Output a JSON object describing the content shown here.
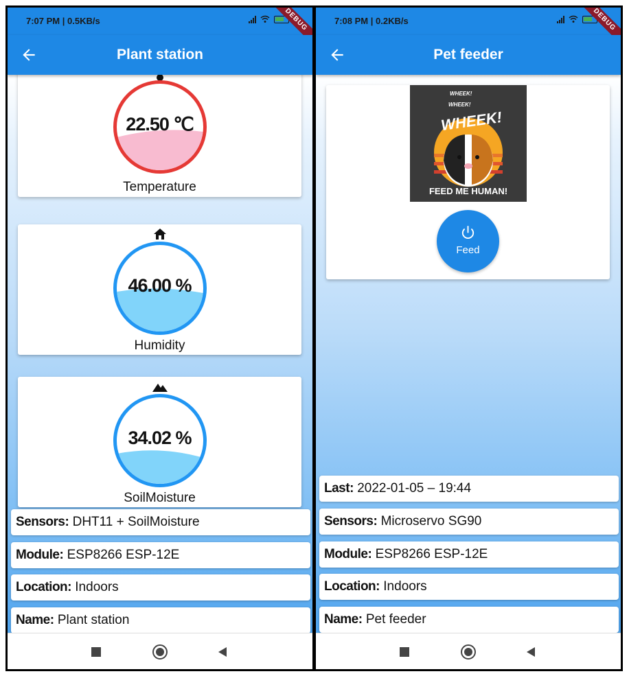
{
  "left": {
    "status": {
      "time": "7:07 PM | 0.5KB/s",
      "debug": "DEBUG"
    },
    "title": "Plant station",
    "gauges": [
      {
        "value": "22.50 ℃",
        "label": "Temperature",
        "icon": "thermometer-icon",
        "fill": 0.38,
        "ring_color": "#e53935",
        "liquid_color": "#f8bbd0"
      },
      {
        "value": "46.00 %",
        "label": "Humidity",
        "icon": "home-icon",
        "fill": 0.46,
        "ring_color": "#2196f3",
        "liquid_color": "#81d4fa"
      },
      {
        "value": "34.02 %",
        "label": "SoilMoisture",
        "icon": "mountain-icon",
        "fill": 0.34,
        "ring_color": "#2196f3",
        "liquid_color": "#81d4fa"
      }
    ],
    "info": [
      {
        "key": "Sensors:",
        "value": "DHT11 + SoilMoisture"
      },
      {
        "key": "Module:",
        "value": "ESP8266 ESP-12E"
      },
      {
        "key": "Location:",
        "value": "Indoors"
      },
      {
        "key": "Name:",
        "value": "Plant station"
      }
    ]
  },
  "right": {
    "status": {
      "time": "7:08 PM | 0.2KB/s",
      "debug": "DEBUG"
    },
    "title": "Pet feeder",
    "image": {
      "texts": [
        "WHEEK!",
        "WHEEK!",
        "WHEEK!",
        "FEED ME HUMAN!"
      ]
    },
    "feed_button": "Feed",
    "info": [
      {
        "key": "Last:",
        "value": "2022-01-05 – 19:44"
      },
      {
        "key": "Sensors:",
        "value": "Microservo SG90"
      },
      {
        "key": "Module:",
        "value": "ESP8266 ESP-12E"
      },
      {
        "key": "Location:",
        "value": "Indoors"
      },
      {
        "key": "Name:",
        "value": "Pet feeder"
      }
    ]
  },
  "colors": {
    "app_bar": "#1e88e5",
    "accent": "#2196f3",
    "temperature": "#e53935"
  }
}
